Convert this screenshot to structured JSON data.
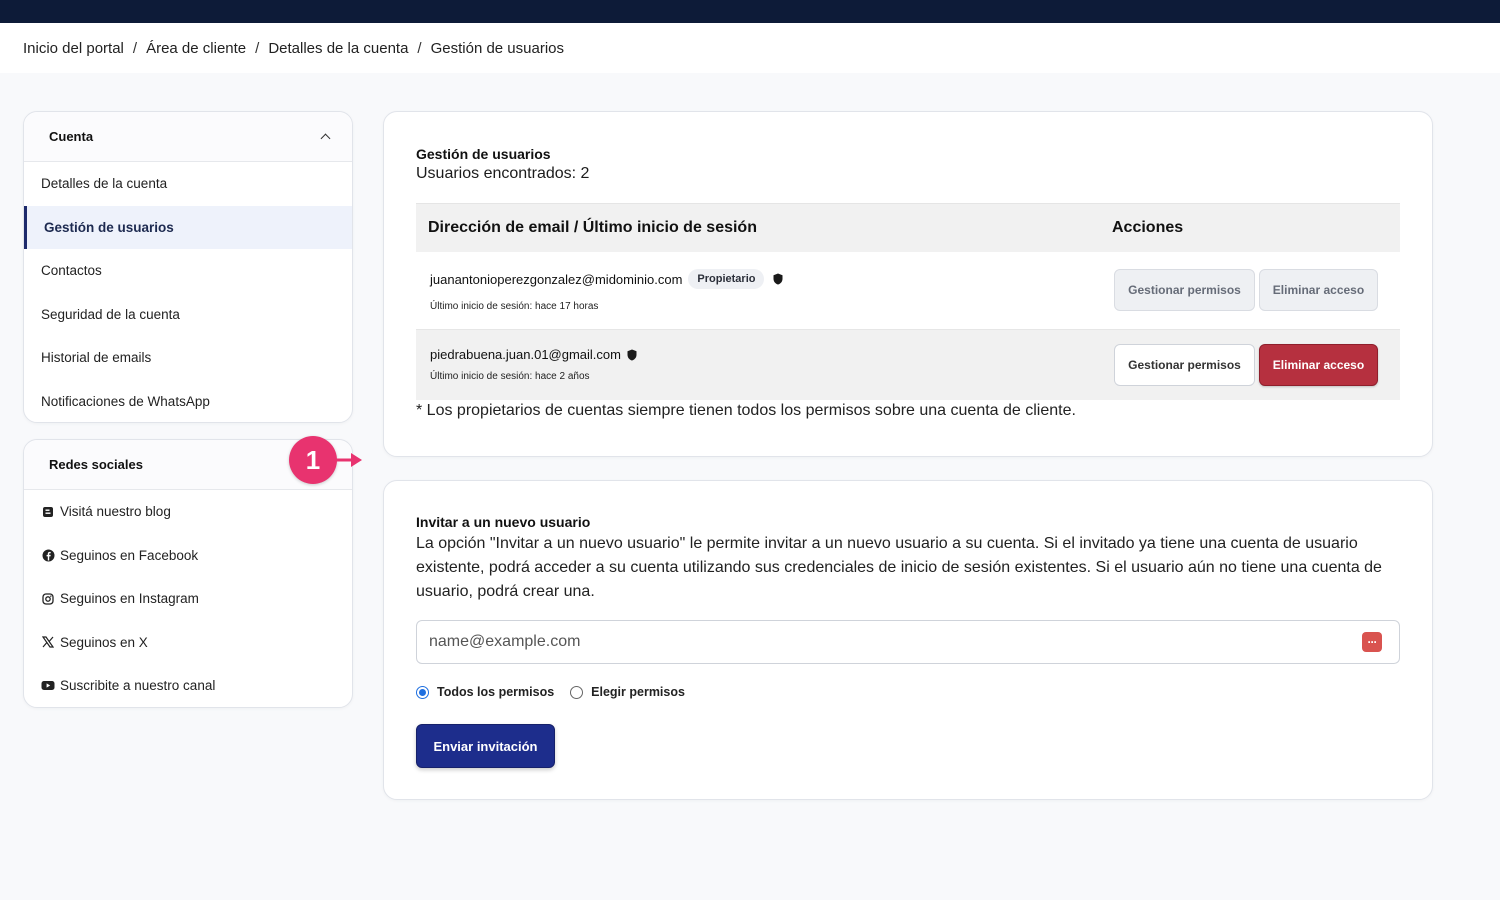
{
  "breadcrumb": [
    "Inicio del portal",
    "Área de cliente",
    "Detalles de la cuenta",
    "Gestión de usuarios"
  ],
  "sidebar": {
    "account": {
      "title": "Cuenta",
      "items": [
        {
          "label": "Detalles de la cuenta"
        },
        {
          "label": "Gestión de usuarios",
          "active": true
        },
        {
          "label": "Contactos"
        },
        {
          "label": "Seguridad de la cuenta"
        },
        {
          "label": "Historial de emails"
        },
        {
          "label": "Notificaciones de WhatsApp"
        }
      ]
    },
    "social": {
      "title": "Redes sociales",
      "items": [
        {
          "label": "Visitá nuestro blog",
          "icon": "blog-icon"
        },
        {
          "label": "Seguinos en Facebook",
          "icon": "facebook-icon"
        },
        {
          "label": "Seguinos en Instagram",
          "icon": "instagram-icon"
        },
        {
          "label": "Seguinos en X",
          "icon": "x-icon"
        },
        {
          "label": "Suscribite a nuestro canal",
          "icon": "youtube-icon"
        }
      ]
    }
  },
  "users": {
    "title": "Gestión de usuarios",
    "count_label": "Usuarios encontrados: 2",
    "columns": [
      "Dirección de email / Último inicio de sesión",
      "Acciones"
    ],
    "rows": [
      {
        "email": "juanantonioperezgonzalez@midominio.com",
        "badge": "Propietario",
        "last_login": "Último inicio de sesión: hace 17 horas",
        "manage_label": "Gestionar permisos",
        "remove_label": "Eliminar acceso"
      },
      {
        "email": "piedrabuena.juan.01@gmail.com",
        "last_login": "Último inicio de sesión: hace 2 años",
        "manage_label": "Gestionar permisos",
        "remove_label": "Eliminar acceso"
      }
    ],
    "note": "* Los propietarios de cuentas siempre tienen todos los permisos sobre una cuenta de cliente."
  },
  "invite": {
    "title": "Invitar a un nuevo usuario",
    "description": "La opción \"Invitar a un nuevo usuario\" le permite invitar a un nuevo usuario a su cuenta. Si el invitado ya tiene una cuenta de usuario existente, podrá acceder a su cuenta utilizando sus credenciales de inicio de sesión existentes. Si el usuario aún no tiene una cuenta de usuario, podrá crear una.",
    "email_placeholder": "name@example.com",
    "radio_all": "Todos los permisos",
    "radio_choose": "Elegir permisos",
    "radio_all_selected": true,
    "send_label": "Enviar invitación"
  },
  "annotation": {
    "marker": "1"
  },
  "colors": {
    "navy": "#0d1b38",
    "danger": "#b6303f",
    "primary": "#1d2d8c",
    "marker": "#e8336f"
  }
}
